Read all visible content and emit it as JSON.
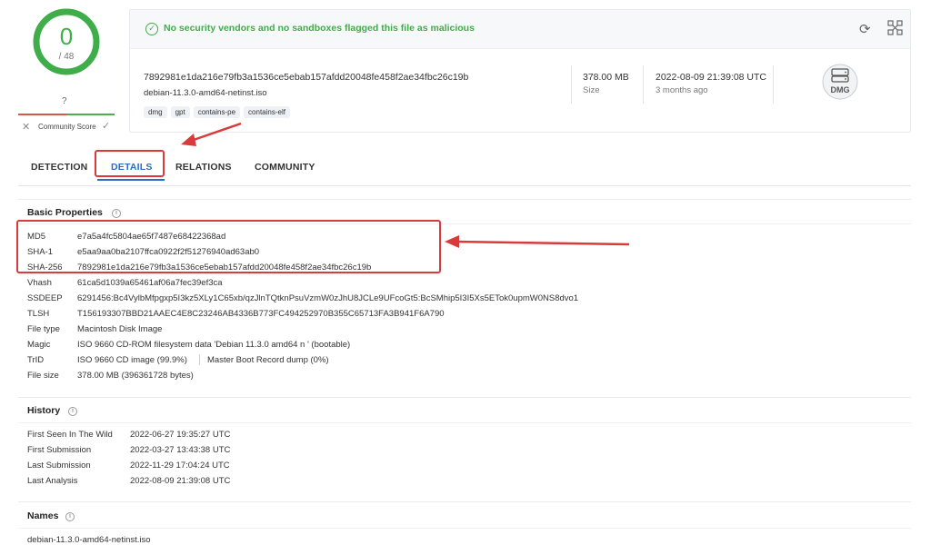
{
  "score": {
    "detections": "0",
    "total": "/ 48",
    "color": "#3fae4a"
  },
  "community": {
    "score": "?",
    "label": "Community Score",
    "dislike_icon": "x-icon",
    "like_icon": "check-icon"
  },
  "banner": {
    "message": "No security vendors and no sandboxes flagged this file as malicious"
  },
  "file": {
    "sha256": "7892981e1da216e79fb3a1536ce5ebab157afdd20048fe458f2ae34fbc26c19b",
    "name": "debian-11.3.0-amd64-netinst.iso",
    "tags": [
      "dmg",
      "gpt",
      "contains-pe",
      "contains-elf"
    ],
    "size": "378.00 MB",
    "size_label": "Size",
    "date": "2022-08-09 21:39:08 UTC",
    "date_relative": "3 months ago",
    "type_icon": "DMG"
  },
  "tabs": [
    "DETECTION",
    "DETAILS",
    "RELATIONS",
    "COMMUNITY"
  ],
  "basic_properties": {
    "title": "Basic Properties",
    "rows": [
      {
        "key": "MD5",
        "value": "e7a5a4fc5804ae65f7487e68422368ad"
      },
      {
        "key": "SHA-1",
        "value": "e5aa9aa0ba2107ffca0922f2f51276940ad63ab0"
      },
      {
        "key": "SHA-256",
        "value": "7892981e1da216e79fb3a1536ce5ebab157afdd20048fe458f2ae34fbc26c19b"
      },
      {
        "key": "Vhash",
        "value": "61ca5d1039a65461af06a7fec39ef3ca"
      },
      {
        "key": "SSDEEP",
        "value": "6291456:Bc4VylbMfpgxp5I3kz5XLy1C65xb/qzJlnTQtknPsuVzmW0zJhU8JCLe9UFcoGt5:BcSMhip5I3I5Xs5ETok0upmW0NS8dvo1"
      },
      {
        "key": "TLSH",
        "value": "T156193307BBD21AAEC4E8C23246AB4336B773FC494252970B355C65713FA3B941F6A790"
      },
      {
        "key": "File type",
        "value": "Macintosh Disk Image"
      },
      {
        "key": "Magic",
        "value": "ISO 9660 CD-ROM filesystem data 'Debian 11.3.0 amd64 n ' (bootable)"
      },
      {
        "key": "TrID",
        "value": "ISO 9660 CD image (99.9%)",
        "value2": "Master Boot Record dump (0%)"
      },
      {
        "key": "File size",
        "value": "378.00 MB (396361728 bytes)"
      }
    ]
  },
  "history": {
    "title": "History",
    "rows": [
      {
        "key": "First Seen In The Wild",
        "value": "2022-06-27 19:35:27 UTC"
      },
      {
        "key": "First Submission",
        "value": "2022-03-27 13:43:38 UTC"
      },
      {
        "key": "Last Submission",
        "value": "2022-11-29 17:04:24 UTC"
      },
      {
        "key": "Last Analysis",
        "value": "2022-08-09 21:39:08 UTC"
      }
    ]
  },
  "names": {
    "title": "Names",
    "first": "debian-11.3.0-amd64-netinst.iso"
  },
  "colors": {
    "accent": "#2b6cc4",
    "clean": "#3fae4a",
    "annotation": "#d93a3a"
  }
}
